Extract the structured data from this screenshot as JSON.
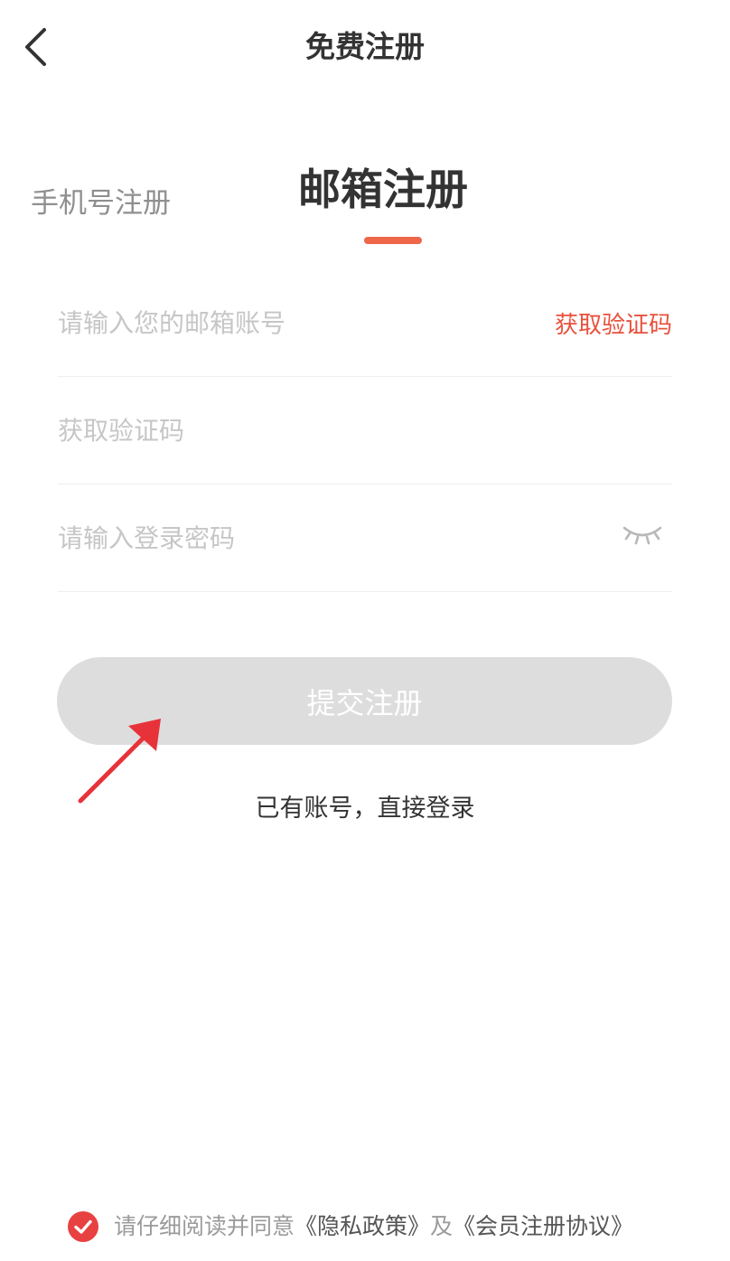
{
  "header": {
    "title": "免费注册",
    "back_icon": "chevron-left-icon"
  },
  "tabs": {
    "phone_label": "手机号注册",
    "email_label": "邮箱注册",
    "active": "email"
  },
  "form": {
    "email": {
      "value": "",
      "placeholder": "请输入您的邮箱账号",
      "get_code_label": "获取验证码"
    },
    "code": {
      "value": "",
      "placeholder": "获取验证码"
    },
    "password": {
      "value": "",
      "placeholder": "请输入登录密码",
      "toggle_icon": "eye-closed-icon"
    }
  },
  "submit": {
    "label": "提交注册"
  },
  "login_link": {
    "label": "已有账号，直接登录"
  },
  "agreement": {
    "checked": true,
    "prefix": "请仔细阅读并同意",
    "privacy_label": "《隐私政策》",
    "connector": "及",
    "terms_label": "《会员注册协议》"
  },
  "colors": {
    "accent": "#f0664a",
    "link_red": "#e8513d",
    "disabled_button": "#dddddd",
    "check_red": "#e84141",
    "annotation_arrow": "#e8323a"
  }
}
